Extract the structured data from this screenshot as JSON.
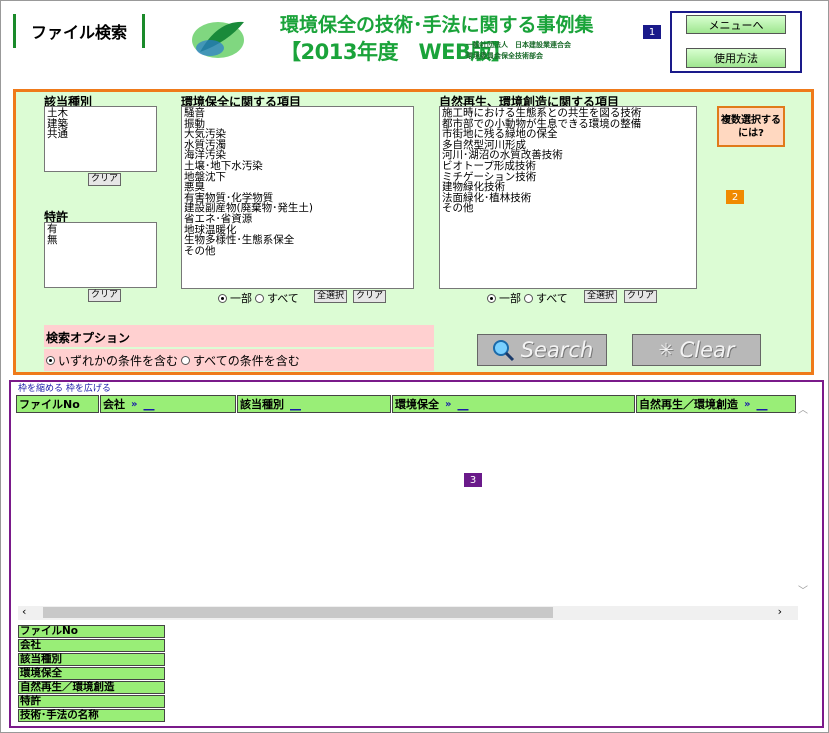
{
  "header": {
    "page_title": "ファイル検索",
    "banner_line1": "環境保全の技術･手法に関する事例集",
    "banner_line2": "【2013年度　WEB版】",
    "org_line1": "一般社団法人　日本建設業連合会",
    "org_line2": "環境委員会保全技術部会"
  },
  "badges": {
    "b1": "1",
    "b2": "2",
    "b3": "3"
  },
  "top_buttons": {
    "menu": "メニューへ",
    "usage": "使用方法"
  },
  "search": {
    "category": {
      "label": "該当種別",
      "options": [
        "土木",
        "建築",
        "共通"
      ],
      "clear": "クリア"
    },
    "patent": {
      "label": "特許",
      "options": [
        "有",
        "無"
      ],
      "clear": "クリア"
    },
    "env": {
      "label": "環境保全に関する項目",
      "options": [
        "騒音",
        "振動",
        "大気汚染",
        "水質汚濁",
        "海洋汚染",
        "土壌･地下水汚染",
        "地盤沈下",
        "悪臭",
        "有害物質･化学物質",
        "建設副産物(廃棄物･発生土)",
        "省エネ･省資源",
        "地球温暖化",
        "生物多様性･生態系保全",
        "その他"
      ],
      "mode_partial": "一部",
      "mode_all": "すべて",
      "select_all": "全選択",
      "clear": "クリア"
    },
    "nature": {
      "label": "自然再生、環境創造に関する項目",
      "options": [
        "施工時における生態系との共生を図る技術",
        "都市部での小動物が生息できる環境の整備",
        "市街地に残る緑地の保全",
        "多自然型河川形成",
        "河川･湖沼の水質改善技術",
        "ビオトープ形成技術",
        "ミチゲーション技術",
        "建物緑化技術",
        "法面緑化･植林技術",
        "その他"
      ],
      "mode_partial": "一部",
      "mode_all": "すべて",
      "select_all": "全選択",
      "clear": "クリア"
    },
    "multi_help": "複数選択するには?",
    "options_label": "検索オプション",
    "option_any": "いずれかの条件を含む",
    "option_all": "すべての条件を含む",
    "search_btn": "Search",
    "clear_btn": "Clear"
  },
  "results": {
    "link_shrink": "枠を縮める",
    "link_expand": "枠を広げる",
    "columns": [
      "ファイルNo",
      "会社",
      "該当種別",
      "環境保全",
      "自然再生／環境創造"
    ],
    "column_list": [
      "ファイルNo",
      "会社",
      "該当種別",
      "環境保全",
      "自然再生／環境創造",
      "特許",
      "技術･手法の名称"
    ]
  }
}
